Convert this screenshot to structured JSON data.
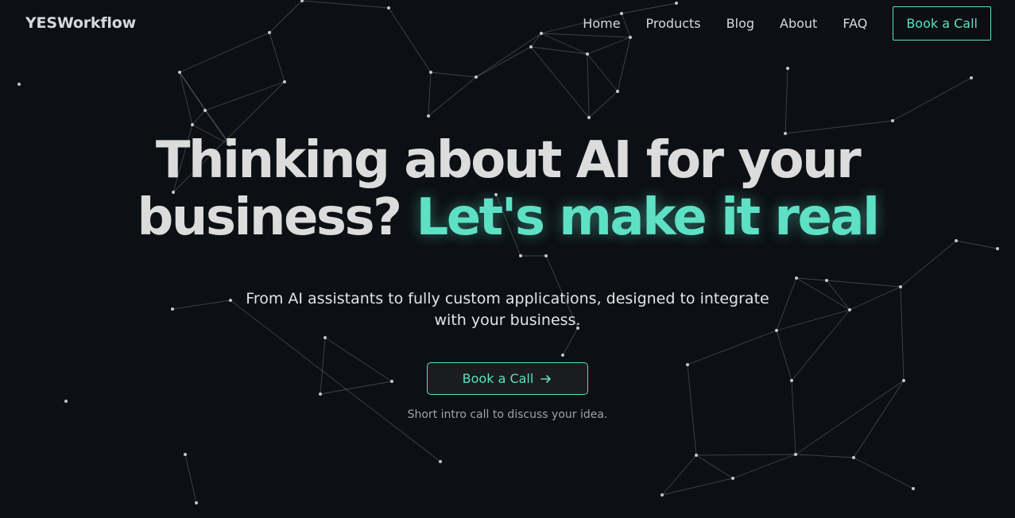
{
  "header": {
    "logo": "YESWorkflow",
    "nav": [
      {
        "label": "Home",
        "name": "nav-home"
      },
      {
        "label": "Products",
        "name": "nav-products"
      },
      {
        "label": "Blog",
        "name": "nav-blog"
      },
      {
        "label": "About",
        "name": "nav-about"
      },
      {
        "label": "FAQ",
        "name": "nav-faq"
      }
    ],
    "cta_label": "Book a Call"
  },
  "hero": {
    "title_line1": "Thinking about AI for your",
    "title_line2_plain": "business?",
    "title_line2_accent": "Let's make it real",
    "subtitle_line1": "From AI assistants to fully custom applications, designed to integrate",
    "subtitle_line2": "with your business.",
    "cta_label": "Book a Call",
    "cta_icon": "arrow-right-icon",
    "cta_note": "Short intro call to discuss your idea."
  },
  "theme": {
    "background": "#0c0f14",
    "accent": "#5ee0c4",
    "text": "#dcdcdd",
    "muted": "#9ea3aa"
  },
  "background_decoration": "network-graph"
}
